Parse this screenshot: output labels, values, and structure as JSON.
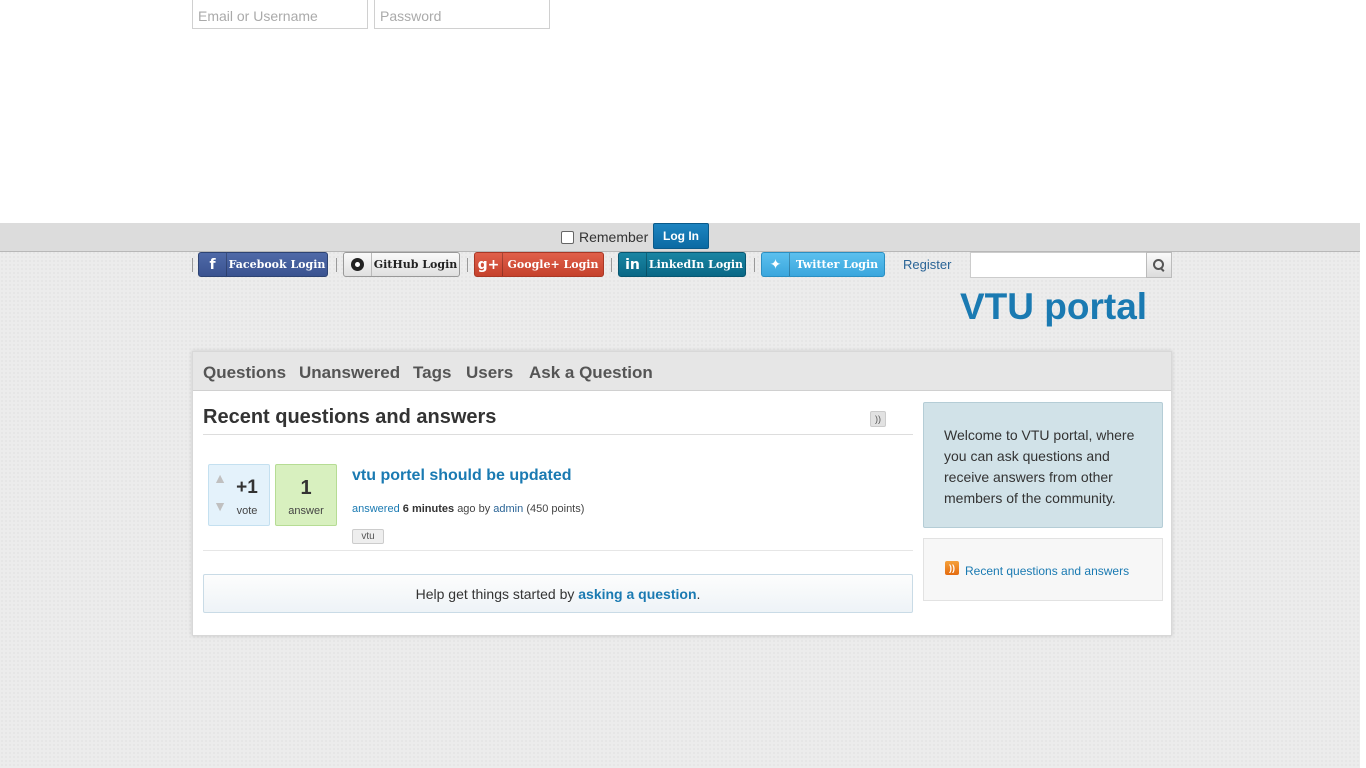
{
  "login": {
    "email_placeholder": "Email or Username",
    "password_placeholder": "Password",
    "remember_label": "Remember",
    "login_button": "Log In"
  },
  "social": {
    "facebook": "Facebook Login",
    "github": "GitHub Login",
    "google": "Google+ Login",
    "linkedin": "LinkedIn Login",
    "twitter": "Twitter Login",
    "register": "Register"
  },
  "colors": {
    "accent": "#1a7ab2",
    "facebook": "#3a5390",
    "google": "#c5412c",
    "linkedin": "#0a6886",
    "twitter": "#3aa6dd"
  },
  "site_title": "VTU portal",
  "nav": {
    "questions": "Questions",
    "unanswered": "Unanswered",
    "tags": "Tags",
    "users": "Users",
    "ask": "Ask a Question"
  },
  "main": {
    "heading": "Recent questions and answers",
    "question": {
      "vote_count": "+1",
      "vote_label": "vote",
      "answer_count": "1",
      "answer_label": "answer",
      "title": "vtu portel should be updated",
      "meta_action": "answered",
      "meta_time": "6 minutes",
      "meta_ago": "ago by",
      "meta_user": "admin",
      "meta_points": "(450 points)",
      "tag": "vtu"
    },
    "suggest_prefix": "Help get things started by ",
    "suggest_link": "asking a question",
    "suggest_suffix": "."
  },
  "sidebar": {
    "welcome": "Welcome to VTU portal, where you can ask questions and receive answers from other members of the community.",
    "feed_link": "Recent questions and answers"
  }
}
